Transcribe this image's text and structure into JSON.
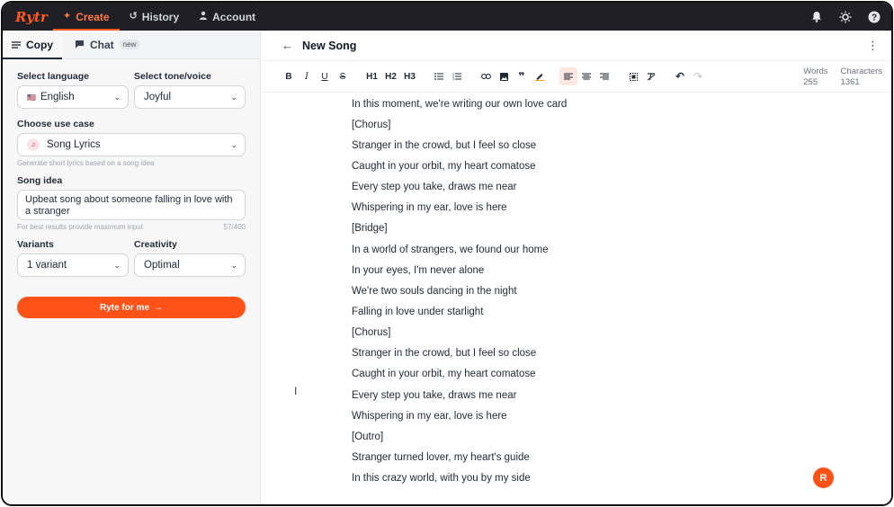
{
  "app": {
    "logo": "Rytr"
  },
  "nav": {
    "create": "Create",
    "history": "History",
    "account": "Account"
  },
  "left_tabs": {
    "copy": "Copy",
    "chat": "Chat",
    "chat_badge": "new"
  },
  "form": {
    "language_label": "Select language",
    "language_value": "English",
    "tone_label": "Select tone/voice",
    "tone_value": "Joyful",
    "use_case_label": "Choose use case",
    "use_case_value": "Song Lyrics",
    "use_case_hint": "Generate short lyrics based on a song idea",
    "idea_label": "Song idea",
    "idea_value": "Upbeat song about someone falling in love with a stranger",
    "idea_hint": "For best results provide maximum input",
    "idea_count": "57/400",
    "variants_label": "Variants",
    "variants_value": "1 variant",
    "creativity_label": "Creativity",
    "creativity_value": "Optimal",
    "submit_label": "Ryte for me"
  },
  "editor": {
    "title": "New Song",
    "words_label": "Words",
    "words_value": "255",
    "chars_label": "Characters",
    "chars_value": "1361",
    "toolbar": {
      "bold": "B",
      "italic": "I",
      "underline": "U",
      "strike": "S",
      "h1": "H1",
      "h2": "H2",
      "h3": "H3"
    },
    "lines": [
      "In this moment, we're writing our own love card",
      "[Chorus]",
      "Stranger in the crowd, but I feel so close",
      "Caught in your orbit, my heart comatose",
      "Every step you take, draws me near",
      "Whispering in my ear, love is here",
      "[Bridge]",
      "In a world of strangers, we found our home",
      "In your eyes, I'm never alone",
      "We're two souls dancing in the night",
      "Falling in love under starlight",
      "[Chorus]",
      "Stranger in the crowd, but I feel so close",
      "Caught in your orbit, my heart comatose",
      "Every step you take, draws me near",
      "Whispering in my ear, love is here",
      "[Outro]",
      "Stranger turned lover, my heart's guide",
      "In this crazy world, with you by my side"
    ]
  },
  "fab_label": "R",
  "colors": {
    "accent": "#ff5219",
    "topbar": "#1f1f25"
  }
}
